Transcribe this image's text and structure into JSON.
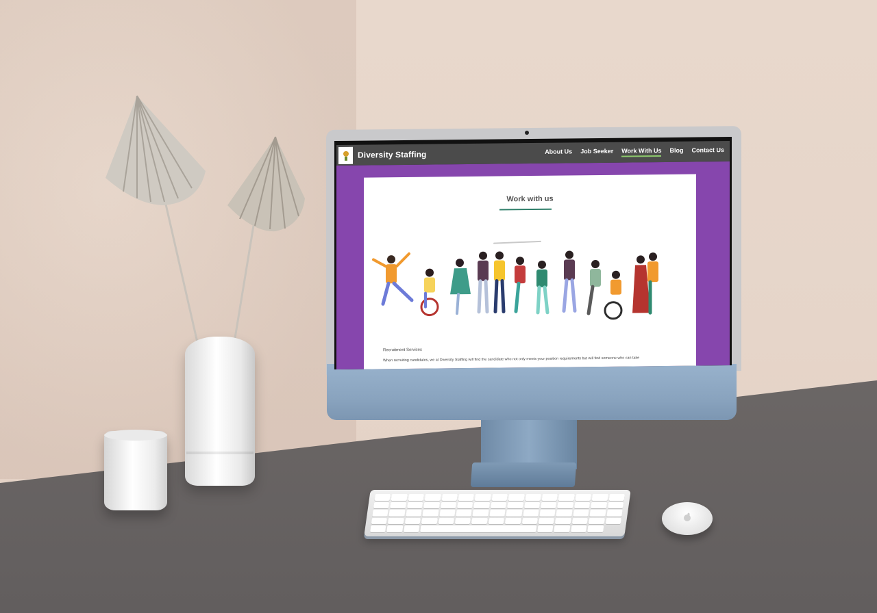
{
  "site": {
    "brand": "Diversity Staffing",
    "nav": [
      {
        "label": "About Us",
        "active": false
      },
      {
        "label": "Job Seeker",
        "active": false
      },
      {
        "label": "Work With Us",
        "active": true
      },
      {
        "label": "Blog",
        "active": false
      },
      {
        "label": "Contact Us",
        "active": false
      }
    ],
    "page_title": "Work with us",
    "section_heading": "Recruitment Services",
    "body_text": "When recruiting candidates, we at Diversity Staffing will find the candidate who not only meets your position requirements but will find someone who can take"
  },
  "colors": {
    "nav_bg": "#4b4b4b",
    "page_bg": "#8646ad",
    "active_underline": "#8ecb6d",
    "title_rule": "#2f7f6a"
  },
  "icons": {
    "logo": "company-logo-icon",
    "mouse_logo": "apple-logo-icon"
  }
}
